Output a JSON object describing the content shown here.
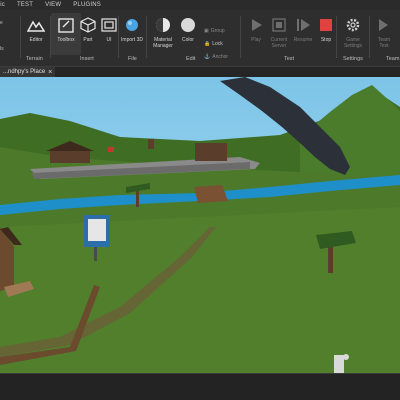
{
  "menu": [
    "ric",
    "TEST",
    "VIEW",
    "PLUGINS"
  ],
  "ribbon": {
    "buttons": [
      {
        "label": "Editor"
      },
      {
        "label": "Toolbox"
      },
      {
        "label": "Part"
      },
      {
        "label": "UI"
      },
      {
        "label": "Import 3D"
      },
      {
        "label": "Material Manager"
      },
      {
        "label": "Color"
      },
      {
        "label": "Play"
      },
      {
        "label": "Current Server"
      },
      {
        "label": "Resume"
      },
      {
        "label": "Stop"
      },
      {
        "label": "Game Settings"
      },
      {
        "label": "Team Test"
      }
    ],
    "small_items": {
      "group": "Group",
      "lock": "Lock",
      "anchor": "Anchor"
    },
    "groups": [
      "Terrain",
      "Insert",
      "File",
      "Edit",
      "Test",
      "Settings",
      "Team"
    ],
    "left_partial": [
      "e",
      "ls"
    ]
  },
  "tab": {
    "title": "...ndhpy's Place",
    "close": "×"
  },
  "colors": {
    "stop": "#e0423f",
    "import": "#4aa3e3",
    "sky": "#9dd4ee",
    "grass": "#4c7a2a"
  }
}
